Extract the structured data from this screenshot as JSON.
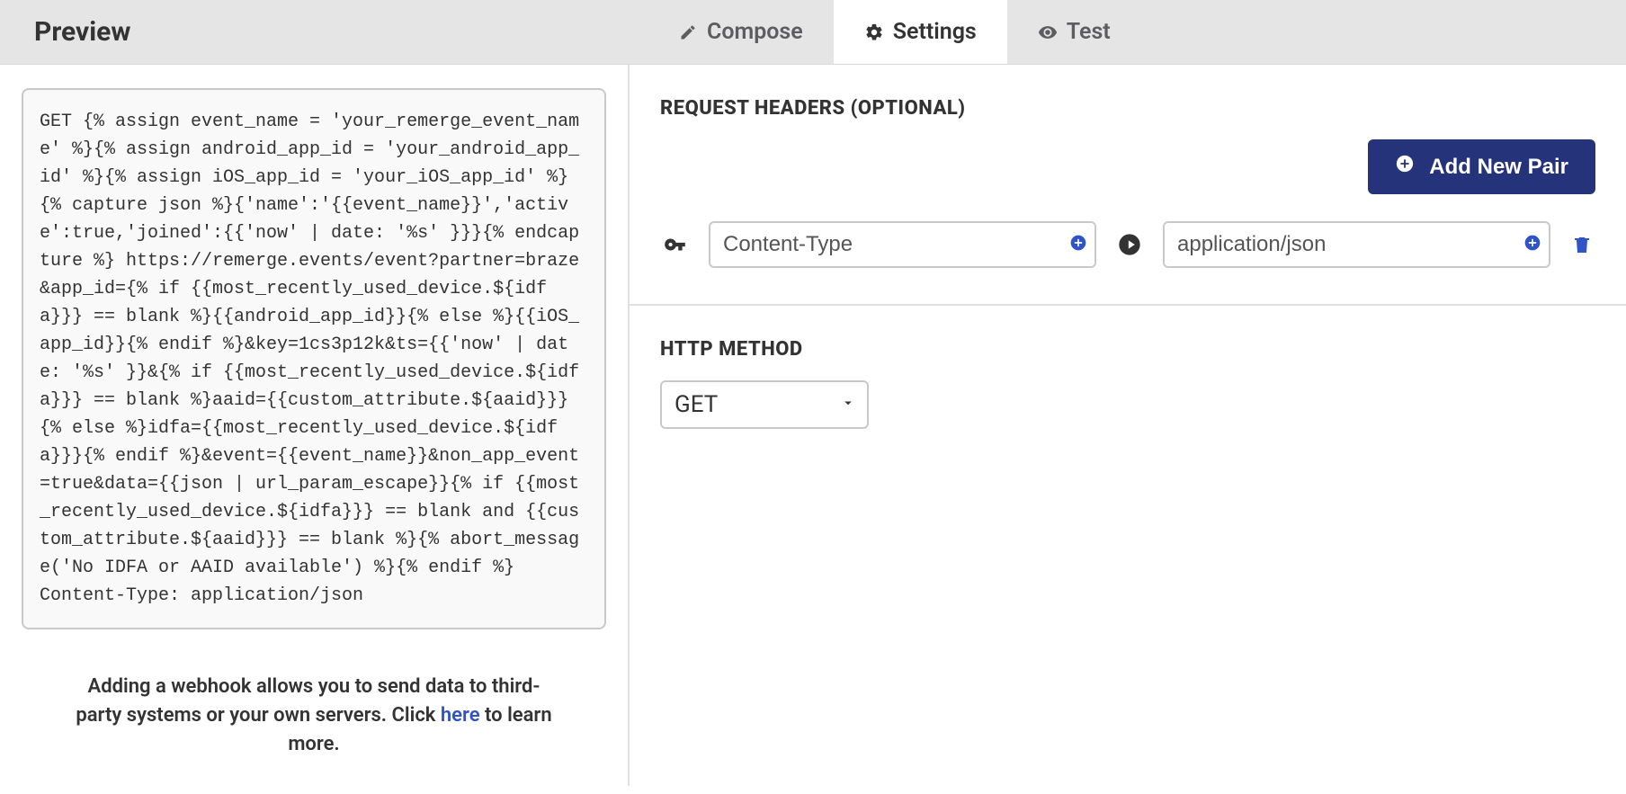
{
  "header": {
    "preview_title": "Preview",
    "tabs": {
      "compose": "Compose",
      "settings": "Settings",
      "test": "Test"
    }
  },
  "preview": {
    "code": "GET {% assign event_name = 'your_remerge_event_name' %}{% assign android_app_id = 'your_android_app_id' %}{% assign iOS_app_id = 'your_iOS_app_id' %} {% capture json %}{'name':'{{event_name}}','active':true,'joined':{{'now' | date: '%s' }}}{% endcapture %} https://remerge.events/event?partner=braze&app_id={% if {{most_recently_used_device.${idfa}}} == blank %}{{android_app_id}}{% else %}{{iOS_app_id}}{% endif %}&key=1cs3p12k&ts={{'now' | date: '%s' }}&{% if {{most_recently_used_device.${idfa}}} == blank %}aaid={{custom_attribute.${aaid}}}{% else %}idfa={{most_recently_used_device.${idfa}}}{% endif %}&event={{event_name}}&non_app_event=true&data={{json | url_param_escape}}{% if {{most_recently_used_device.${idfa}}} == blank and {{custom_attribute.${aaid}}} == blank %}{% abort_message('No IDFA or AAID available') %}{% endif %}\nContent-Type: application/json",
    "helper_pre": "Adding a webhook allows you to send data to third-party systems or your own servers. Click ",
    "helper_link": "here",
    "helper_post": " to learn more."
  },
  "settings": {
    "headers_label": "REQUEST HEADERS (OPTIONAL)",
    "add_pair_label": "Add New Pair",
    "pair": {
      "key": "Content-Type",
      "value": "application/json"
    },
    "http_method_label": "HTTP METHOD",
    "http_method_value": "GET"
  }
}
